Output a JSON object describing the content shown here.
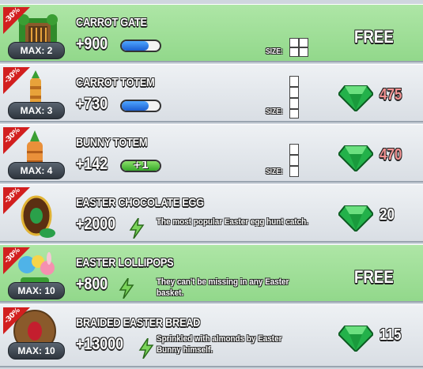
{
  "colors": {
    "green_row": "#9ddd96",
    "gray_row": "#e3e7ec",
    "ribbon": "#d21f1f",
    "gem": "#22b84a",
    "price_insufficient": "#f29393"
  },
  "items": [
    {
      "title": "CARROT GATE",
      "value": "+900",
      "badge": "-30%",
      "max": "MAX: 2",
      "bar": "blue",
      "size_label": "SIZE:",
      "size": "2x2",
      "price": "FREE",
      "row": "green",
      "icon": "carrot-gate-icon"
    },
    {
      "title": "CARROT TOTEM",
      "value": "+730",
      "badge": "-30%",
      "max": "MAX: 3",
      "bar": "blue",
      "size_label": "SIZE:",
      "size": "1x3",
      "price": "475",
      "price_style": "red",
      "row": "gray",
      "icon": "carrot-totem-icon"
    },
    {
      "title": "BUNNY TOTEM",
      "value": "+142",
      "badge": "-30%",
      "max": "MAX: 4",
      "bar": "green",
      "bar_label": "+1",
      "size_label": "SIZE:",
      "size": "1x3",
      "price": "470",
      "price_style": "red",
      "row": "gray",
      "icon": "bunny-totem-icon"
    },
    {
      "title": "EASTER CHOCOLATE EGG",
      "value": "+2000",
      "badge": "-30%",
      "desc": "The most popular Easter egg hunt catch.",
      "price": "20",
      "row": "gray",
      "icon": "chocolate-egg-icon"
    },
    {
      "title": "EASTER LOLLIPOPS",
      "value": "+800",
      "badge": "-30%",
      "max": "MAX: 10",
      "desc": "They can't be missing in any Easter basket.",
      "price": "FREE",
      "row": "green",
      "icon": "lollipops-icon"
    },
    {
      "title": "BRAIDED EASTER BREAD",
      "value": "+13000",
      "badge": "-30%",
      "max": "MAX: 10",
      "desc": "Sprinkled with almonds by Easter Bunny himself.",
      "price": "115",
      "row": "gray",
      "icon": "easter-bread-icon"
    }
  ]
}
